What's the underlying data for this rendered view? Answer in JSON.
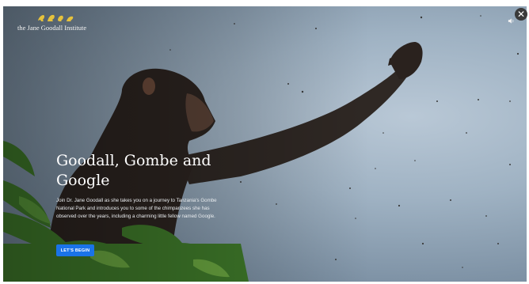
{
  "brand": {
    "name": "the Jane Goodall Institute",
    "mark_icon": "chimpanzee-figures-logo-icon",
    "mark_color": "#e6c23c"
  },
  "controls": {
    "close_icon": "close-icon",
    "close_glyph": "✕",
    "sound_icon": "speaker-icon"
  },
  "hero": {
    "title": "Goodall, Gombe and Google",
    "description": "Join Dr. Jane Goodall as she takes you on a journey to Tanzania's Gombe National Park and introduces you to some of the chimpanzees she has observed over the years, including a charming little fellow named Google.",
    "cta_label": "LET'S BEGIN",
    "cta_color": "#1a73e8"
  }
}
